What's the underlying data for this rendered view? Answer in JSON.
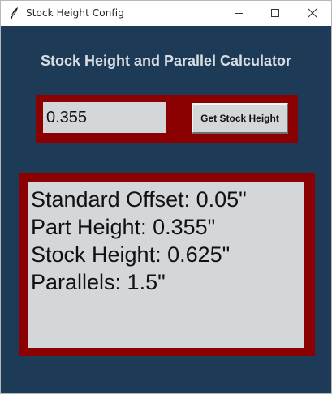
{
  "window": {
    "title": "Stock Height Config",
    "controls": {
      "minimize": "minimize-icon",
      "maximize": "maximize-icon",
      "close": "close-icon"
    }
  },
  "app": {
    "heading": "Stock Height and Parallel Calculator",
    "input": {
      "value": "0.355"
    },
    "button_label": "Get Stock Height",
    "results": {
      "standard_offset": "Standard Offset: 0.05\"",
      "part_height": "Part Height: 0.355\"",
      "stock_height": "Stock Height: 0.625\"",
      "parallels": "Parallels: 1.5\""
    }
  },
  "colors": {
    "background": "#1d3a56",
    "frame": "#8b0000",
    "field": "#d4d7da",
    "heading_text": "#d8dde2"
  }
}
